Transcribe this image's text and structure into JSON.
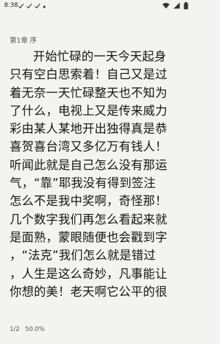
{
  "status_bar": {
    "time": "8:38",
    "left_icons": [
      "check-icon",
      "check-icon",
      "check-icon",
      "notification-dot-icon"
    ],
    "right_icons": [
      "wifi-icon",
      "cellular-icon",
      "battery-icon"
    ]
  },
  "chapter": {
    "title": "第1章 序"
  },
  "body_lines": [
    "开始忙碌的一天今天起身",
    "只有空白思索着！自己又是过",
    "着无奈一天忙碌整天也不知为",
    "了什么，电视上又是传来威力",
    "彩由某人某地开出独得真是恭",
    "喜贺喜台湾又多亿万有钱人！",
    "听闻此就是自己怎么没有那运",
    "气，“靠”耶我没有得到签注",
    "怎么不是我中奖啊，奇怪那！",
    "几个数字我们再怎么看起来就",
    "是面熟，蒙眼随便也会戳到字",
    "，“法克”我们怎么就是错过",
    "，人生是这么奇妙，凡事能让",
    "你想的美！老天啊它公平的很"
  ],
  "footer": {
    "page": "1/2",
    "progress": "50.0%"
  },
  "colors": {
    "background": "#f3f3f1",
    "text": "#151515",
    "muted": "#555555"
  }
}
